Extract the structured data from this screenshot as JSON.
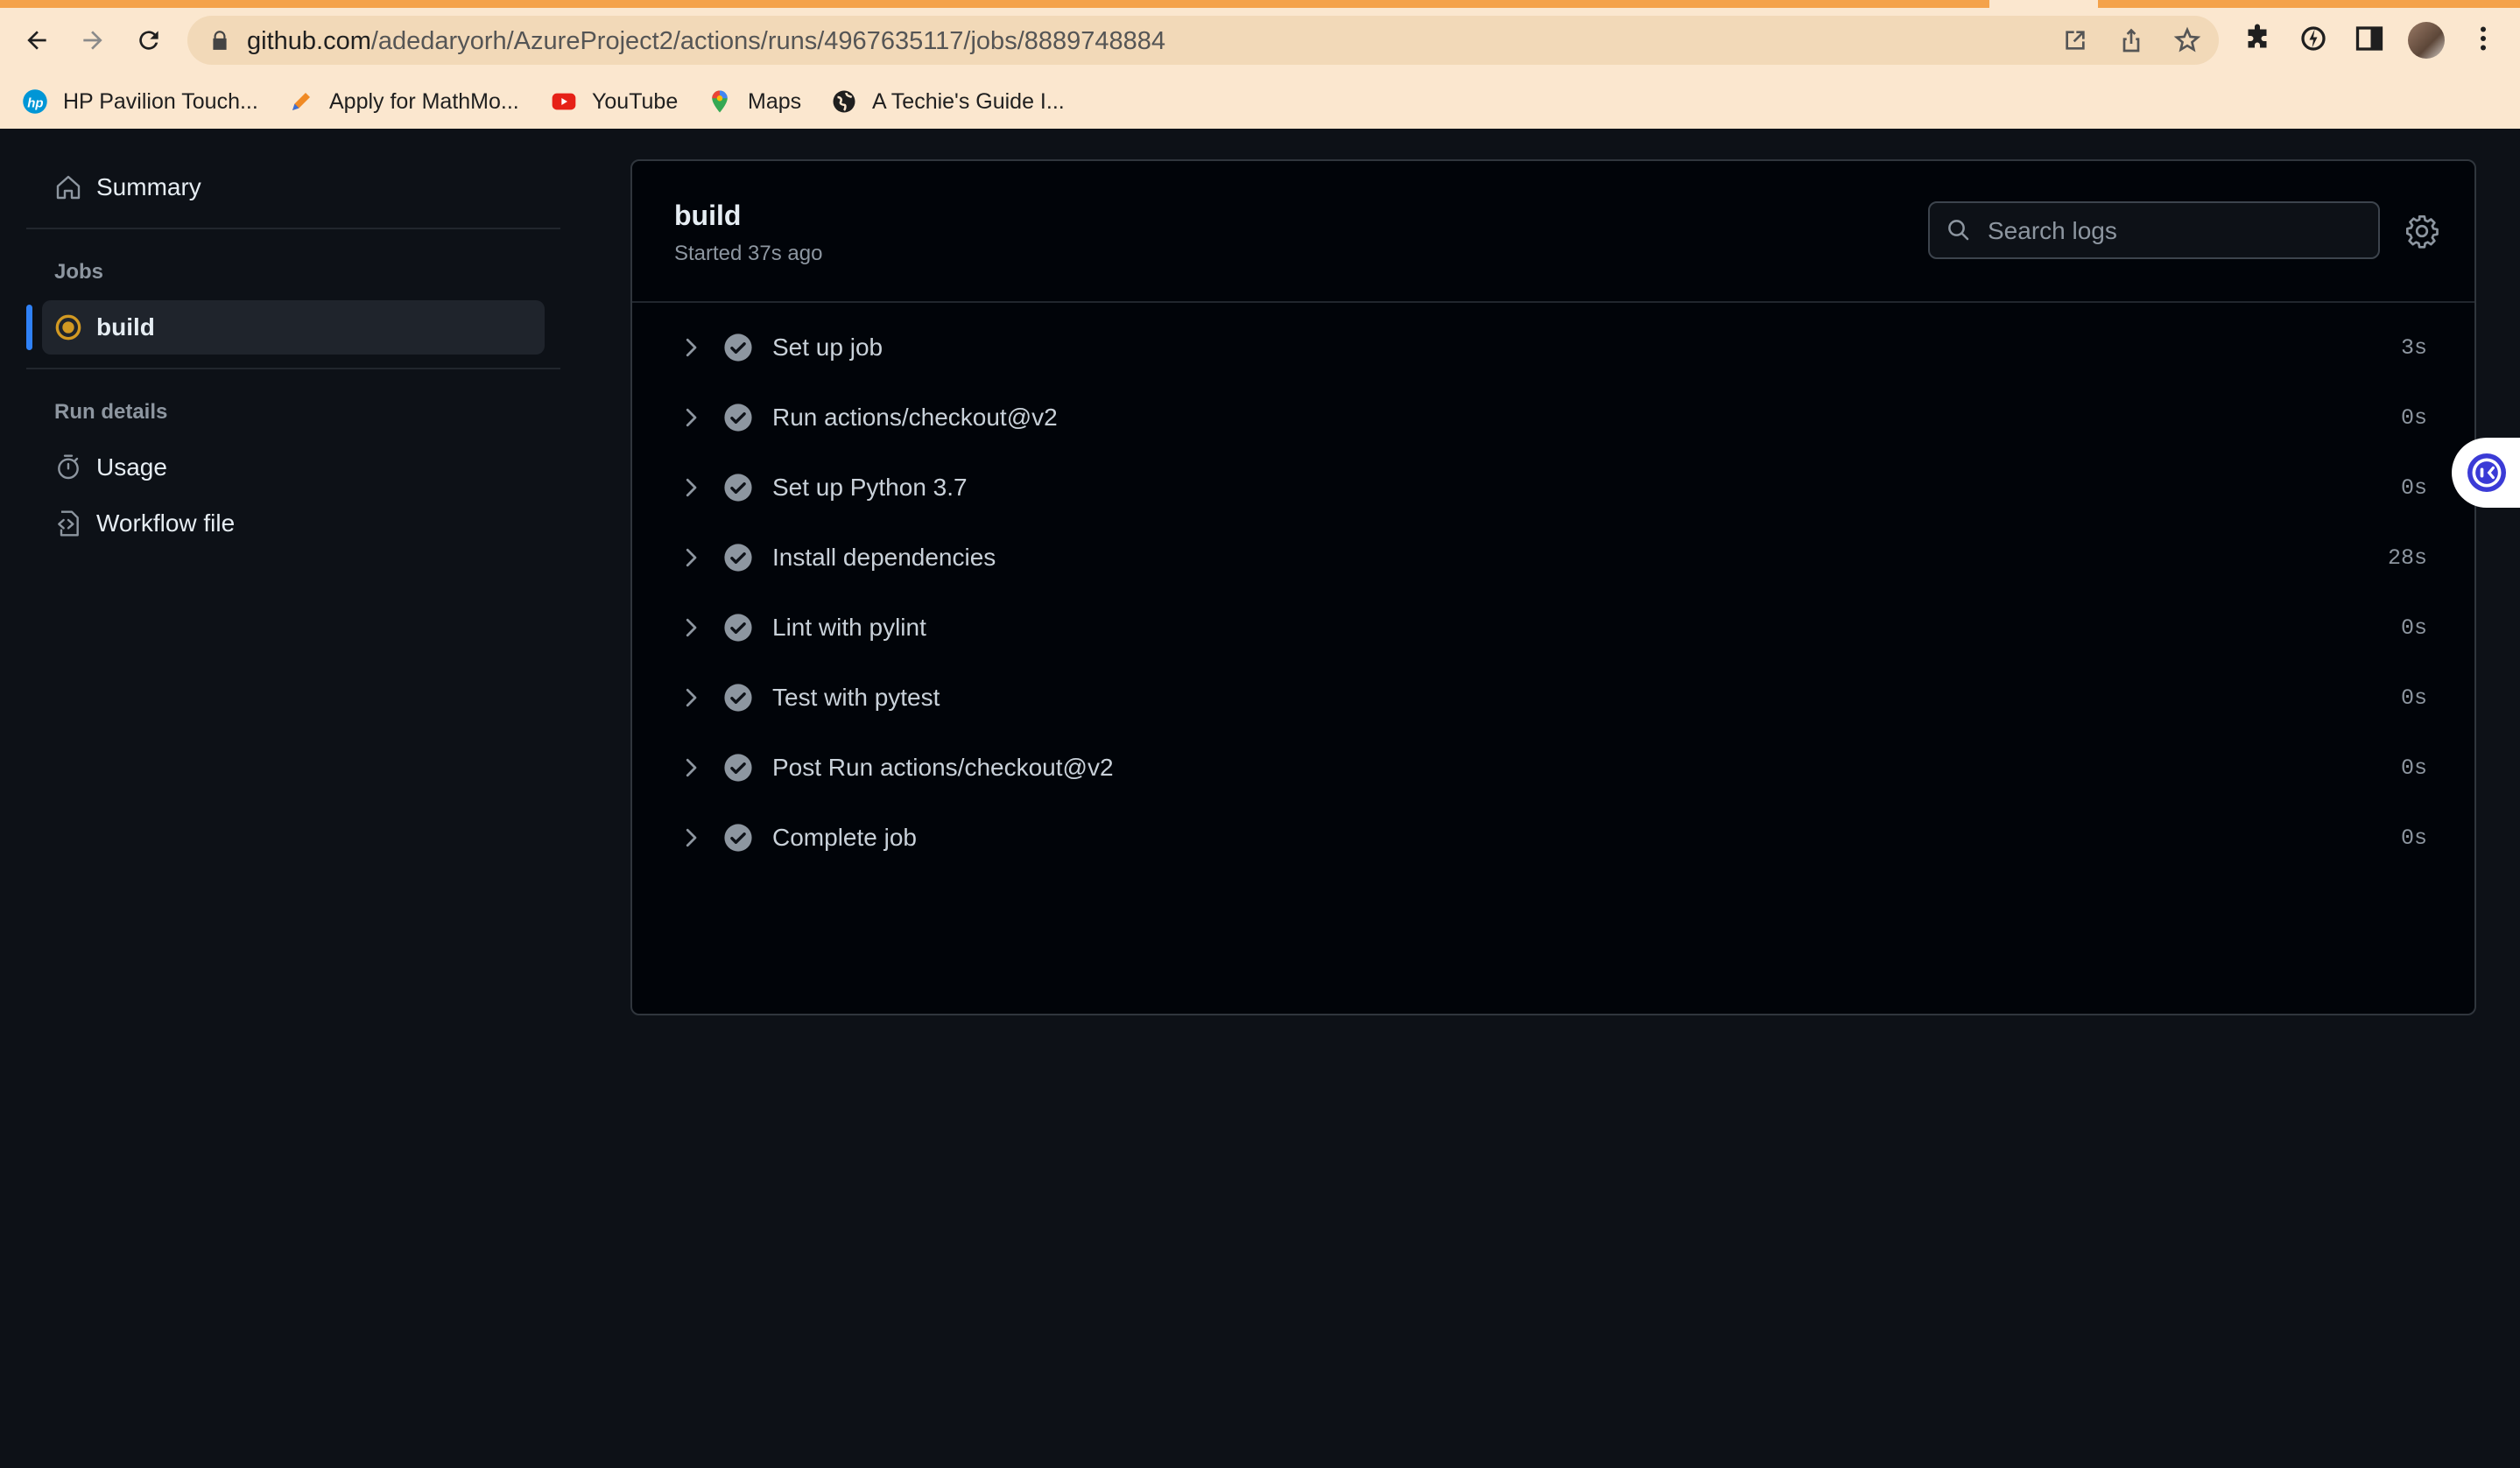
{
  "browser": {
    "url_host": "github.com",
    "url_path": "/adedaryorh/AzureProject2/actions/runs/4967635117/jobs/8889748884",
    "bookmarks": [
      {
        "label": "HP Pavilion Touch...",
        "icon": "hp-logo-icon"
      },
      {
        "label": "Apply for MathMo...",
        "icon": "pencil-icon"
      },
      {
        "label": "YouTube",
        "icon": "youtube-icon"
      },
      {
        "label": "Maps",
        "icon": "maps-pin-icon"
      },
      {
        "label": "A Techie's Guide I...",
        "icon": "globe-icon"
      }
    ]
  },
  "sidebar": {
    "summary_label": "Summary",
    "jobs_heading": "Jobs",
    "active_job": "build",
    "run_details_heading": "Run details",
    "usage_label": "Usage",
    "workflow_file_label": "Workflow file"
  },
  "job": {
    "title": "build",
    "subtitle": "Started 37s ago",
    "search_placeholder": "Search logs",
    "steps": [
      {
        "name": "Set up job",
        "duration": "3s"
      },
      {
        "name": "Run actions/checkout@v2",
        "duration": "0s"
      },
      {
        "name": "Set up Python 3.7",
        "duration": "0s"
      },
      {
        "name": "Install dependencies",
        "duration": "28s"
      },
      {
        "name": "Lint with pylint",
        "duration": "0s"
      },
      {
        "name": "Test with pytest",
        "duration": "0s"
      },
      {
        "name": "Post Run actions/checkout@v2",
        "duration": "0s"
      },
      {
        "name": "Complete job",
        "duration": "0s"
      }
    ]
  },
  "colors": {
    "accent": "#2f81f7",
    "in_progress": "#d29922",
    "page_bg": "#0d1117",
    "chrome_bg": "#fbe7cf"
  }
}
